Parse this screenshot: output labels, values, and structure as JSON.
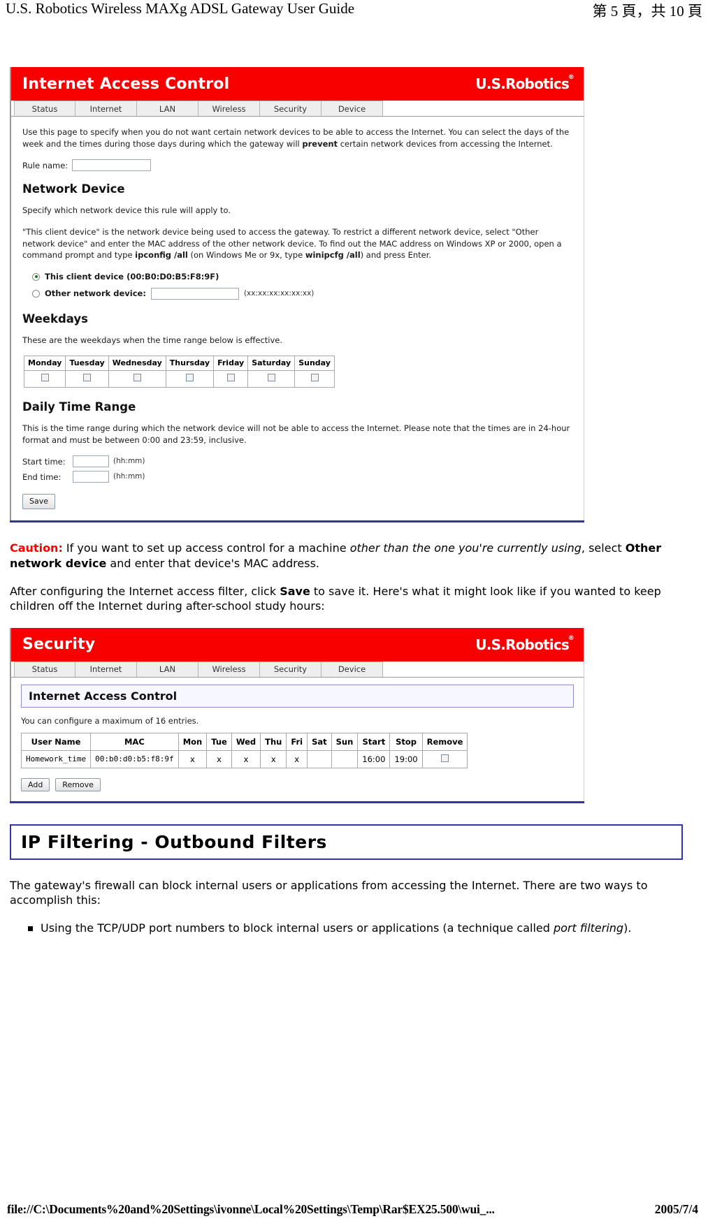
{
  "page_header": {
    "doc_title": "U.S. Robotics Wireless MAXg ADSL Gateway User Guide",
    "page_indicator": "第 5 頁，共 10 頁"
  },
  "page_footer": {
    "file_path": "file://C:\\Documents%20and%20Settings\\ivonne\\Local%20Settings\\Temp\\Rar$EX25.500\\wui_...",
    "date": "2005/7/4"
  },
  "colors": {
    "banner_red": "#f90000",
    "rule_blue": "#33339c",
    "caution_red": "#ff0000",
    "radio_green": "#157a15"
  },
  "panel1": {
    "banner_title": "Internet Access Control",
    "brand": "U.S.Robotics",
    "brand_mark": "®",
    "tabs": [
      {
        "label": "Status"
      },
      {
        "label": "Internet"
      },
      {
        "label": "LAN"
      },
      {
        "label": "Wireless"
      },
      {
        "label": "Security"
      },
      {
        "label": "Device"
      }
    ],
    "intro_part1": "Use this page to specify when you do not want certain network devices to be able to access the Internet. You can select the days of the week and the times during those days during which the gateway will ",
    "intro_bold": "prevent",
    "intro_part2": " certain network devices from accessing the Internet.",
    "rule_name_label": "Rule name:",
    "rule_name_value": "",
    "network_device_heading": "Network Device",
    "network_device_desc": "Specify which network device this rule will apply to.",
    "client_desc_p1": "\"This client device\" is the network device being used to access the gateway. To restrict a different network device, select \"Other network device\" and enter the MAC address of the other network device. To find out the MAC address on Windows XP or 2000, open a command prompt and type ",
    "client_desc_b1": "ipconfig /all",
    "client_desc_p2": " (on Windows Me or 9x, type ",
    "client_desc_b2": "winipcfg /all",
    "client_desc_p3": ") and press Enter.",
    "radio_this_client": "This client device (00:B0:D0:B5:F8:9F)",
    "radio_this_client_selected": true,
    "radio_other_device": "Other network device:",
    "other_device_value": "",
    "mac_format_hint": "(xx:xx:xx:xx:xx:xx)",
    "weekdays_heading": "Weekdays",
    "weekdays_desc": "These are the weekdays when the time range below is effective.",
    "weekday_headers": [
      "Monday",
      "Tuesday",
      "Wednesday",
      "Thursday",
      "Friday",
      "Saturday",
      "Sunday"
    ],
    "weekday_checked": [
      false,
      false,
      false,
      false,
      false,
      false,
      false
    ],
    "time_range_heading": "Daily Time Range",
    "time_range_desc": "This is the time range during which the network device will not be able to access the Internet. Please note that the times are in 24-hour format and must be between 0:00 and 23:59, inclusive.",
    "start_time_label": "Start time:",
    "start_time_value": "",
    "start_time_hint": "(hh:mm)",
    "end_time_label": "End time:",
    "end_time_value": "",
    "end_time_hint": "(hh:mm)",
    "save_label": "Save"
  },
  "caution": {
    "label": "Caution:",
    "text_p1": " If you want to set up access control for a machine ",
    "text_em1": "other than the one you're currently using",
    "text_p2": ", select ",
    "text_b1": "Other network device",
    "text_p3": " and enter that device's MAC address."
  },
  "after_config": {
    "part1": "After configuring the Internet access filter, click ",
    "bold": "Save",
    "part2": " to save it. Here's what it might look like if you wanted to keep children off the Internet during after-school study hours:"
  },
  "panel2": {
    "banner_title": "Security",
    "brand": "U.S.Robotics",
    "brand_mark": "®",
    "tabs": [
      {
        "label": "Status"
      },
      {
        "label": "Internet"
      },
      {
        "label": "LAN"
      },
      {
        "label": "Wireless"
      },
      {
        "label": "Security"
      },
      {
        "label": "Device"
      }
    ],
    "subhead": "Internet Access Control",
    "max_entries_note": "You can configure a maximum of 16 entries.",
    "table_headers": [
      "User Name",
      "MAC",
      "Mon",
      "Tue",
      "Wed",
      "Thu",
      "Fri",
      "Sat",
      "Sun",
      "Start",
      "Stop",
      "Remove"
    ],
    "rows": [
      {
        "user_name": "Homework_time",
        "mac": "00:b0:d0:b5:f8:9f",
        "mon": "x",
        "tue": "x",
        "wed": "x",
        "thu": "x",
        "fri": "x",
        "sat": "",
        "sun": "",
        "start": "16:00",
        "stop": "19:00",
        "remove_checked": false
      }
    ],
    "add_label": "Add",
    "remove_label": "Remove"
  },
  "ip_filtering": {
    "title": "IP Filtering - Outbound Filters",
    "para1": "The gateway's firewall can block internal users or applications from accessing the Internet. There are two ways to accomplish this:",
    "bullet1_p1": "Using the TCP/UDP port numbers to block internal users or applications (a technique called ",
    "bullet1_em": "port filtering",
    "bullet1_p2": ")."
  }
}
